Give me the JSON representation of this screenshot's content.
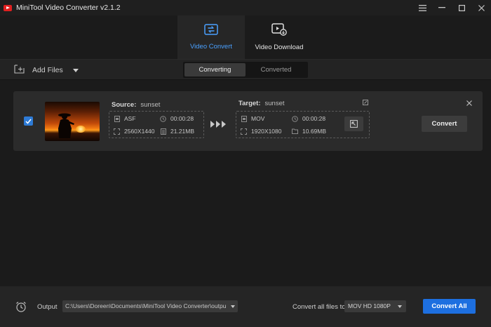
{
  "app": {
    "title": "MiniTool Video Converter v2.1.2"
  },
  "window_controls": [
    "menu-icon",
    "minimize-icon",
    "maximize-icon",
    "close-icon"
  ],
  "nav": {
    "tabs": [
      {
        "label": "Video Convert",
        "icon": "video-convert-icon",
        "active": true
      },
      {
        "label": "Video Download",
        "icon": "video-download-icon",
        "active": false
      }
    ]
  },
  "toolbar": {
    "add_files_label": "Add Files",
    "segments": [
      {
        "label": "Converting",
        "active": true
      },
      {
        "label": "Converted",
        "active": false
      }
    ]
  },
  "task": {
    "checked": true,
    "source": {
      "label": "Source:",
      "name": "sunset",
      "format": "ASF",
      "duration": "00:00:28",
      "resolution": "2560X1440",
      "size": "21.21MB"
    },
    "target": {
      "label": "Target:",
      "name": "sunset",
      "format": "MOV",
      "duration": "00:00:28",
      "resolution": "1920X1080",
      "size": "10.69MB"
    },
    "convert_label": "Convert"
  },
  "bottom": {
    "output_label": "Output",
    "output_path": "C:\\Users\\Doreen\\Documents\\MiniTool Video Converter\\outpu",
    "convert_all_to_label": "Convert all files to",
    "format_value": "MOV HD 1080P",
    "convert_all_label": "Convert All"
  },
  "colors": {
    "accent": "#1d6fe0",
    "active_tab_text": "#4aa0ff",
    "background": "#1b1b1b",
    "card": "#2b2b2b"
  }
}
